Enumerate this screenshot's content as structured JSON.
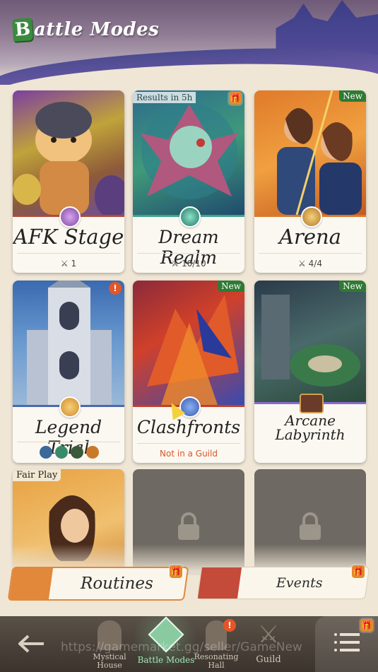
{
  "header": {
    "title_initial": "B",
    "title_rest": "attle Modes"
  },
  "modes": [
    {
      "name": "AFK Stage",
      "sub": "1"
    },
    {
      "name": "Dream Realm",
      "sub": "10/10",
      "tag": "Results in 5h"
    },
    {
      "name": "Arena",
      "sub": "4/4",
      "tag": "New"
    },
    {
      "name": "Legend Trial",
      "tag_icon": "alert-icon"
    },
    {
      "name": "Clashfronts",
      "sub": "Not in a Guild",
      "tag": "New"
    },
    {
      "name_line1": "Arcane",
      "name_line2": "Labyrinth",
      "tag": "New"
    },
    {
      "tag": "Fair Play"
    }
  ],
  "tabs": {
    "routines": "Routines",
    "events": "Events"
  },
  "nav": {
    "back": "back-arrow-icon",
    "items": [
      {
        "line1": "Mystical",
        "line2": "House"
      },
      {
        "line1": "Battle Modes"
      },
      {
        "line1": "Resonating",
        "line2": "Hall"
      },
      {
        "line1": "Guild"
      }
    ]
  },
  "watermark": "https://gamemarket.gg/seller/GameNew",
  "colors": {
    "accent_green": "#3b8a3e",
    "accent_orange": "#e1883a",
    "new_badge": "#2f7a35",
    "alert": "#e2562a"
  }
}
